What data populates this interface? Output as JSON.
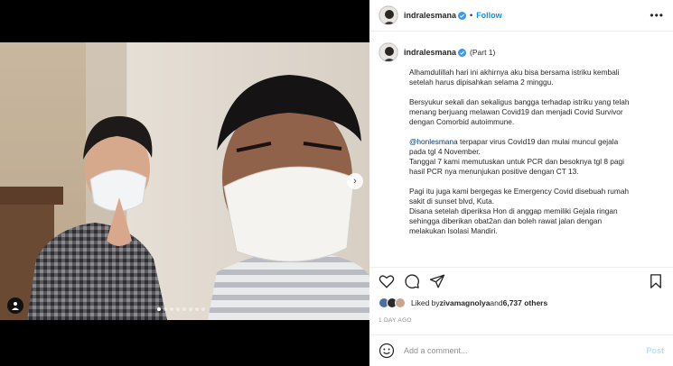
{
  "post": {
    "username": "indralesmana",
    "follow_label": "Follow",
    "dot": "•",
    "more_label": "•••"
  },
  "caption": {
    "username": "indralesmana",
    "part": "(Part 1)",
    "paragraphs": [
      "Alhamdulillah hari ini akhirnya aku bisa bersama istriku kembali\nsetelah harus dipisahkan selama 2 minggu.",
      "Bersyukur sekali dan sekaligus bangga terhadap istriku yang telah\nmenang berjuang melawan Covid19 dan menjadi Covid Survivor\ndengan Comorbid autoimmune."
    ],
    "mention": "@honlesmana",
    "mention_rest": " terpapar virus Covid19 dan mulai muncul gejala\npada tgl 4 November.\nTanggal 7 kami memutuskan untuk PCR dan besoknya tgl 8 pagi\nhasil PCR nya menunjukan positive dengan CT 13.",
    "paragraph_last": "Pagi itu juga kami bergegas ke Emergency Covid disebuah rumah\nsakit di sunset blvd, Kuta.\nDisana setelah diperiksa Hon di anggap memiliki Gejala ringan\nsehingga diberikan obat2an dan boleh rawat jalan dengan\nmelakukan Isolasi Mandiri."
  },
  "likes": {
    "prefix": "Liked by ",
    "user": "zivamagnolya",
    "middle": " and ",
    "count": "6,737 others"
  },
  "timestamp": "1 DAY AGO",
  "comment_box": {
    "placeholder": "Add a comment...",
    "post_label": "Post"
  },
  "carousel": {
    "slides": 8,
    "active": 1
  },
  "colors": {
    "accent": "#0095f6",
    "post_disabled": "#b2dffc",
    "mention": "#00376b"
  },
  "icons": [
    "verified-icon",
    "more-icon",
    "heart-icon",
    "comment-icon",
    "share-icon",
    "bookmark-icon",
    "emoji-icon",
    "next-arrow-icon",
    "user-tag-icon"
  ]
}
